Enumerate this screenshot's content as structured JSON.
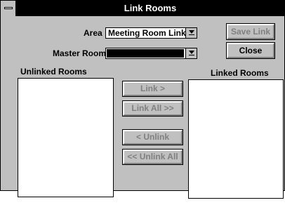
{
  "window": {
    "title": "Link Rooms"
  },
  "form": {
    "area_label": "Area",
    "area_value": "Meeting Room Links",
    "master_room_label": "Master Room",
    "master_room_value": ""
  },
  "buttons": {
    "save_link": "Save Link",
    "close": "Close",
    "link": "Link >",
    "link_all": "Link All >>",
    "unlink": "< Unlink",
    "unlink_all": "<< Unlink All"
  },
  "lists": {
    "unlinked_label": "Unlinked Rooms",
    "unlinked_items": [],
    "linked_label": "Linked Rooms",
    "linked_items": []
  },
  "icons": {
    "system_menu": "system-menu-icon",
    "dropdown": "chevron-down-icon"
  }
}
